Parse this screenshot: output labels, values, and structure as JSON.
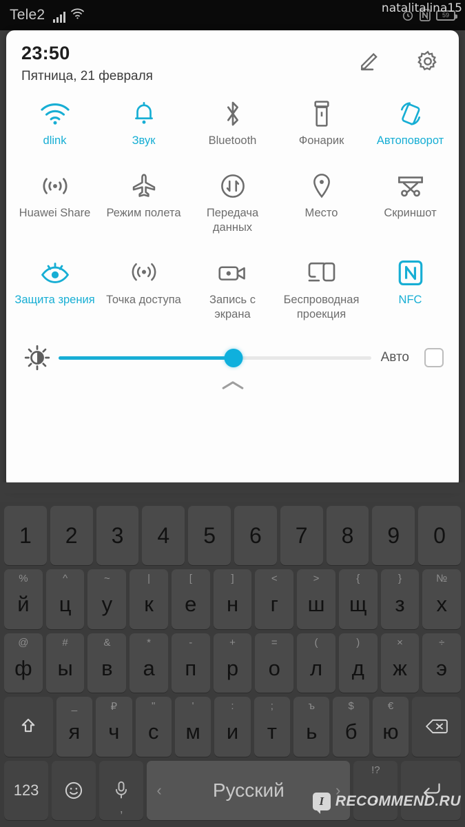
{
  "colors": {
    "accent": "#17aed4",
    "inactive": "#6d6d6d",
    "panel_bg": "#fdfdfd",
    "keyboard_bg": "#3b3b3b"
  },
  "statusbar": {
    "carrier": "Tele2",
    "icons_left": [
      "signal-bars-icon",
      "wifi-icon"
    ],
    "icons_right": [
      "alarm-icon",
      "nfc-icon",
      "battery-icon"
    ],
    "battery_text": "59",
    "watermark": "natalitalina15"
  },
  "panel": {
    "clock": "23:50",
    "date": "Пятница, 21 февраля",
    "edit_icon": "pencil-icon",
    "settings_icon": "gear-icon",
    "collapse_icon": "chevron-up-icon",
    "rows": [
      [
        {
          "label": "dlink",
          "icon": "wifi-icon",
          "active": true
        },
        {
          "label": "Звук",
          "icon": "bell-icon",
          "active": true
        },
        {
          "label": "Bluetooth",
          "icon": "bluetooth-icon",
          "active": false
        },
        {
          "label": "Фонарик",
          "icon": "flashlight-icon",
          "active": false
        },
        {
          "label": "Автоповорот",
          "icon": "auto-rotate-icon",
          "active": true
        }
      ],
      [
        {
          "label": "Huawei Share",
          "icon": "huawei-share-icon",
          "active": false
        },
        {
          "label": "Режим полета",
          "icon": "airplane-icon",
          "active": false
        },
        {
          "label": "Передача данных",
          "icon": "data-transfer-icon",
          "active": false
        },
        {
          "label": "Место",
          "icon": "location-pin-icon",
          "active": false
        },
        {
          "label": "Скриншот",
          "icon": "screenshot-icon",
          "active": false
        }
      ],
      [
        {
          "label": "Защита зрения",
          "icon": "eye-comfort-icon",
          "active": true
        },
        {
          "label": "Точка доступа",
          "icon": "hotspot-icon",
          "active": false
        },
        {
          "label": "Запись с экрана",
          "icon": "screen-record-icon",
          "active": false
        },
        {
          "label": "Беспроводная проекция",
          "icon": "wireless-project-icon",
          "active": false
        },
        {
          "label": "NFC",
          "icon": "nfc-icon",
          "active": true
        }
      ]
    ],
    "brightness": {
      "icon": "brightness-sun-icon",
      "value_percent": 56,
      "auto_label": "Авто",
      "auto_checked": false
    }
  },
  "keyboard": {
    "row_numbers": [
      "1",
      "2",
      "3",
      "4",
      "5",
      "6",
      "7",
      "8",
      "9",
      "0"
    ],
    "row_top": [
      {
        "main": "й",
        "sub": "%"
      },
      {
        "main": "ц",
        "sub": "^"
      },
      {
        "main": "у",
        "sub": "~"
      },
      {
        "main": "к",
        "sub": "|"
      },
      {
        "main": "е",
        "sub": "["
      },
      {
        "main": "н",
        "sub": "]"
      },
      {
        "main": "г",
        "sub": "<"
      },
      {
        "main": "ш",
        "sub": ">"
      },
      {
        "main": "щ",
        "sub": "{"
      },
      {
        "main": "з",
        "sub": "}"
      },
      {
        "main": "х",
        "sub": "№"
      }
    ],
    "row_home": [
      {
        "main": "ф",
        "sub": "@"
      },
      {
        "main": "ы",
        "sub": "#"
      },
      {
        "main": "в",
        "sub": "&"
      },
      {
        "main": "а",
        "sub": "*"
      },
      {
        "main": "п",
        "sub": "-"
      },
      {
        "main": "р",
        "sub": "+"
      },
      {
        "main": "о",
        "sub": "="
      },
      {
        "main": "л",
        "sub": "("
      },
      {
        "main": "д",
        "sub": ")"
      },
      {
        "main": "ж",
        "sub": "×"
      },
      {
        "main": "э",
        "sub": "÷"
      }
    ],
    "row_bottom": [
      {
        "main": "я",
        "sub": "_"
      },
      {
        "main": "ч",
        "sub": "₽"
      },
      {
        "main": "с",
        "sub": "\""
      },
      {
        "main": "м",
        "sub": "'"
      },
      {
        "main": "и",
        "sub": ":"
      },
      {
        "main": "т",
        "sub": ";"
      },
      {
        "main": "ь",
        "sub": "ъ"
      },
      {
        "main": "б",
        "sub": "$"
      },
      {
        "main": "ю",
        "sub": "€"
      }
    ],
    "shift_icon": "shift-icon",
    "backspace_icon": "backspace-icon",
    "numeric_label": "123",
    "emoji_icon": "smiley-icon",
    "mic_icon": "microphone-icon",
    "mic_sub": ",",
    "space_label": "Русский",
    "space_prev": "‹",
    "space_next": "›",
    "period_main": ".",
    "period_sub": "!?",
    "enter_icon": "enter-icon"
  },
  "brand_watermark": {
    "logo": "I",
    "text": "RECOMMEND.RU"
  }
}
